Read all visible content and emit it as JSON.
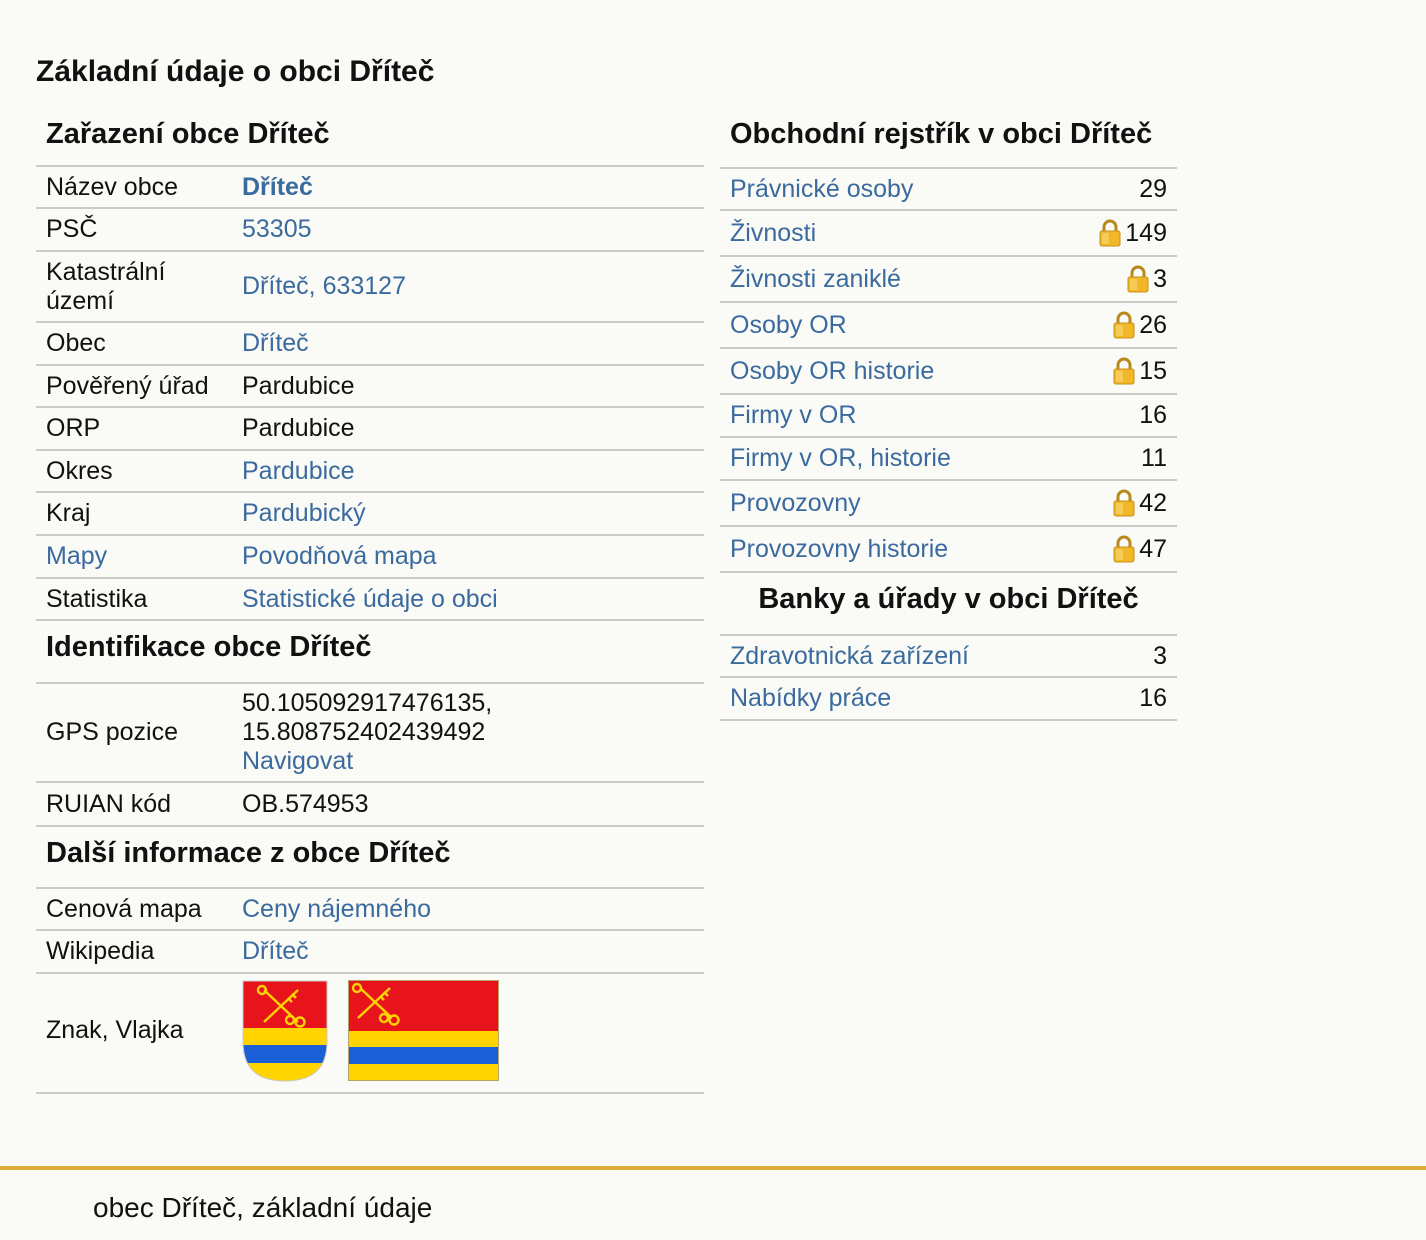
{
  "page": {
    "title": "Základní údaje o obci Dříteč"
  },
  "zarazeni": {
    "heading": "Zařazení obce Dříteč",
    "rows": [
      {
        "label": "Název obce",
        "value": "Dříteč"
      },
      {
        "label": "PSČ",
        "value": "53305"
      },
      {
        "label": "Katastrální území",
        "value": "Dříteč, 633127"
      },
      {
        "label": "Obec",
        "value": "Dříteč"
      },
      {
        "label": "Pověřený úřad",
        "value": "Pardubice"
      },
      {
        "label": "ORP",
        "value": "Pardubice"
      },
      {
        "label": "Okres",
        "value": "Pardubice"
      },
      {
        "label": "Kraj",
        "value": "Pardubický"
      },
      {
        "label": "Mapy",
        "value": "Povodňová mapa"
      },
      {
        "label": "Statistika",
        "value": "Statistické údaje o obci"
      }
    ]
  },
  "identifikace": {
    "heading": "Identifikace obce Dříteč",
    "gps_label": "GPS pozice",
    "gps_lat": "50.105092917476135,",
    "gps_lon": "15.808752402439492",
    "gps_link": "Navigovat",
    "ruian_label": "RUIAN kód",
    "ruian_value": "OB.574953"
  },
  "dalsi": {
    "heading": "Další informace z obce Dříteč",
    "cenova_label": "Cenová mapa",
    "cenova_value": "Ceny nájemného",
    "wiki_label": "Wikipedia",
    "wiki_value": "Dříteč",
    "znak_label": "Znak, Vlajka"
  },
  "rejstrik": {
    "heading": "Obchodní rejstřík v obci Dříteč",
    "rows": [
      {
        "label": "Právnické osoby",
        "count": "29",
        "locked": false
      },
      {
        "label": "Živnosti",
        "count": "149",
        "locked": true
      },
      {
        "label": "Živnosti zaniklé",
        "count": "3",
        "locked": true
      },
      {
        "label": "Osoby OR",
        "count": "26",
        "locked": true
      },
      {
        "label": "Osoby OR historie",
        "count": "15",
        "locked": true
      },
      {
        "label": "Firmy v OR",
        "count": "16",
        "locked": false
      },
      {
        "label": "Firmy v OR, historie",
        "count": "11",
        "locked": false
      },
      {
        "label": "Provozovny",
        "count": "42",
        "locked": true
      },
      {
        "label": "Provozovny historie",
        "count": "47",
        "locked": true
      }
    ]
  },
  "banky": {
    "heading": "Banky a úřady v obci Dříteč",
    "rows": [
      {
        "label": "Zdravotnická zařízení",
        "count": "3"
      },
      {
        "label": "Nabídky práce",
        "count": "16"
      }
    ]
  },
  "footer": {
    "text": "obec Dříteč, základní údaje"
  },
  "colors": {
    "link": "#3a6a9e",
    "border": "#c9c9c9",
    "footer_accent": "#d9ae3a",
    "emblem_red": "#e8141c",
    "emblem_yellow": "#ffd400",
    "emblem_blue": "#1a5fd6"
  },
  "icons": {
    "lock": "padlock-icon",
    "coat_of_arms": "coat-of-arms-icon",
    "flag": "flag-icon"
  }
}
